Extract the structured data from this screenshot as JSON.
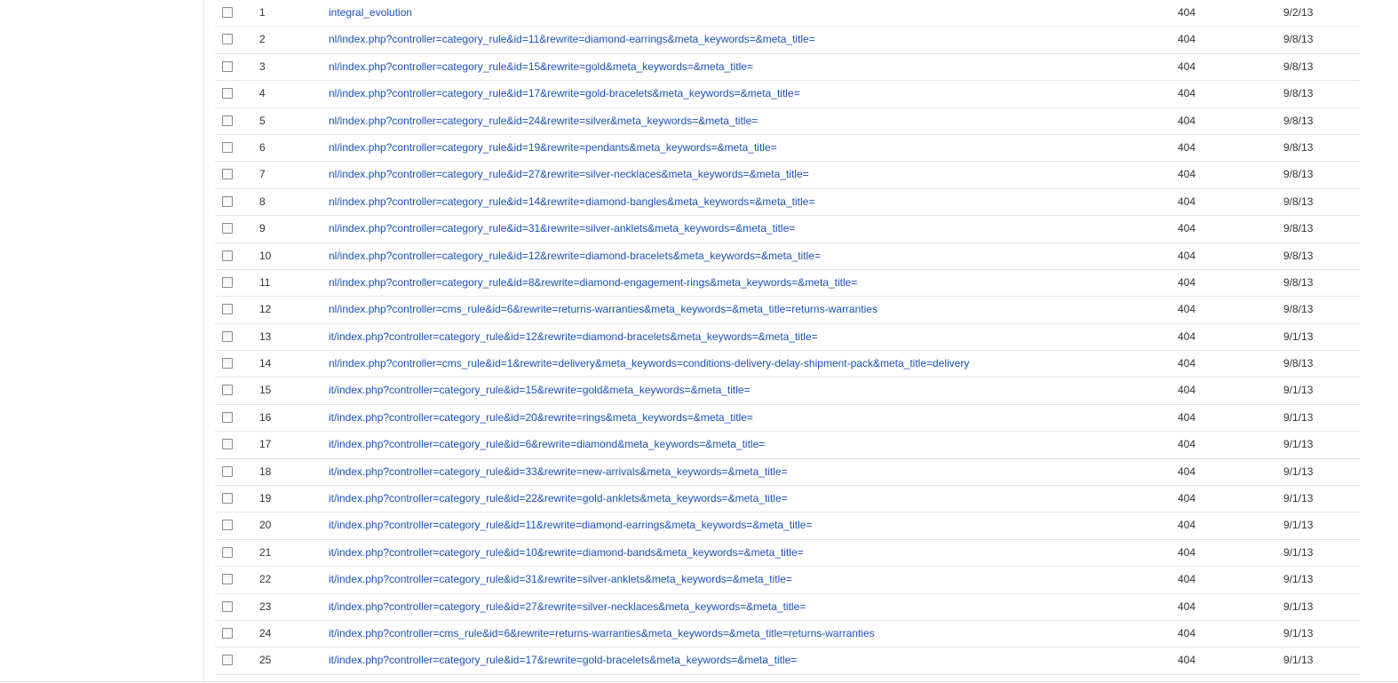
{
  "rows": [
    {
      "num": "1",
      "url": "integral_evolution",
      "code": "404",
      "date": "9/2/13"
    },
    {
      "num": "2",
      "url": "nl/index.php?controller=category_rule&id=11&rewrite=diamond-earrings&meta_keywords=&meta_title=",
      "code": "404",
      "date": "9/8/13"
    },
    {
      "num": "3",
      "url": "nl/index.php?controller=category_rule&id=15&rewrite=gold&meta_keywords=&meta_title=",
      "code": "404",
      "date": "9/8/13"
    },
    {
      "num": "4",
      "url": "nl/index.php?controller=category_rule&id=17&rewrite=gold-bracelets&meta_keywords=&meta_title=",
      "code": "404",
      "date": "9/8/13"
    },
    {
      "num": "5",
      "url": "nl/index.php?controller=category_rule&id=24&rewrite=silver&meta_keywords=&meta_title=",
      "code": "404",
      "date": "9/8/13"
    },
    {
      "num": "6",
      "url": "nl/index.php?controller=category_rule&id=19&rewrite=pendants&meta_keywords=&meta_title=",
      "code": "404",
      "date": "9/8/13"
    },
    {
      "num": "7",
      "url": "nl/index.php?controller=category_rule&id=27&rewrite=silver-necklaces&meta_keywords=&meta_title=",
      "code": "404",
      "date": "9/8/13"
    },
    {
      "num": "8",
      "url": "nl/index.php?controller=category_rule&id=14&rewrite=diamond-bangles&meta_keywords=&meta_title=",
      "code": "404",
      "date": "9/8/13"
    },
    {
      "num": "9",
      "url": "nl/index.php?controller=category_rule&id=31&rewrite=silver-anklets&meta_keywords=&meta_title=",
      "code": "404",
      "date": "9/8/13"
    },
    {
      "num": "10",
      "url": "nl/index.php?controller=category_rule&id=12&rewrite=diamond-bracelets&meta_keywords=&meta_title=",
      "code": "404",
      "date": "9/8/13"
    },
    {
      "num": "11",
      "url": "nl/index.php?controller=category_rule&id=8&rewrite=diamond-engagement-rings&meta_keywords=&meta_title=",
      "code": "404",
      "date": "9/8/13"
    },
    {
      "num": "12",
      "url": "nl/index.php?controller=cms_rule&id=6&rewrite=returns-warranties&meta_keywords=&meta_title=returns-warranties",
      "code": "404",
      "date": "9/8/13"
    },
    {
      "num": "13",
      "url": "it/index.php?controller=category_rule&id=12&rewrite=diamond-bracelets&meta_keywords=&meta_title=",
      "code": "404",
      "date": "9/1/13"
    },
    {
      "num": "14",
      "url": "nl/index.php?controller=cms_rule&id=1&rewrite=delivery&meta_keywords=conditions-delivery-delay-shipment-pack&meta_title=delivery",
      "code": "404",
      "date": "9/8/13"
    },
    {
      "num": "15",
      "url": "it/index.php?controller=category_rule&id=15&rewrite=gold&meta_keywords=&meta_title=",
      "code": "404",
      "date": "9/1/13"
    },
    {
      "num": "16",
      "url": "it/index.php?controller=category_rule&id=20&rewrite=rings&meta_keywords=&meta_title=",
      "code": "404",
      "date": "9/1/13"
    },
    {
      "num": "17",
      "url": "it/index.php?controller=category_rule&id=6&rewrite=diamond&meta_keywords=&meta_title=",
      "code": "404",
      "date": "9/1/13"
    },
    {
      "num": "18",
      "url": "it/index.php?controller=category_rule&id=33&rewrite=new-arrivals&meta_keywords=&meta_title=",
      "code": "404",
      "date": "9/1/13"
    },
    {
      "num": "19",
      "url": "it/index.php?controller=category_rule&id=22&rewrite=gold-anklets&meta_keywords=&meta_title=",
      "code": "404",
      "date": "9/1/13"
    },
    {
      "num": "20",
      "url": "it/index.php?controller=category_rule&id=11&rewrite=diamond-earrings&meta_keywords=&meta_title=",
      "code": "404",
      "date": "9/1/13"
    },
    {
      "num": "21",
      "url": "it/index.php?controller=category_rule&id=10&rewrite=diamond-bands&meta_keywords=&meta_title=",
      "code": "404",
      "date": "9/1/13"
    },
    {
      "num": "22",
      "url": "it/index.php?controller=category_rule&id=31&rewrite=silver-anklets&meta_keywords=&meta_title=",
      "code": "404",
      "date": "9/1/13"
    },
    {
      "num": "23",
      "url": "it/index.php?controller=category_rule&id=27&rewrite=silver-necklaces&meta_keywords=&meta_title=",
      "code": "404",
      "date": "9/1/13"
    },
    {
      "num": "24",
      "url": "it/index.php?controller=cms_rule&id=6&rewrite=returns-warranties&meta_keywords=&meta_title=returns-warranties",
      "code": "404",
      "date": "9/1/13"
    },
    {
      "num": "25",
      "url": "it/index.php?controller=category_rule&id=17&rewrite=gold-bracelets&meta_keywords=&meta_title=",
      "code": "404",
      "date": "9/1/13"
    }
  ]
}
